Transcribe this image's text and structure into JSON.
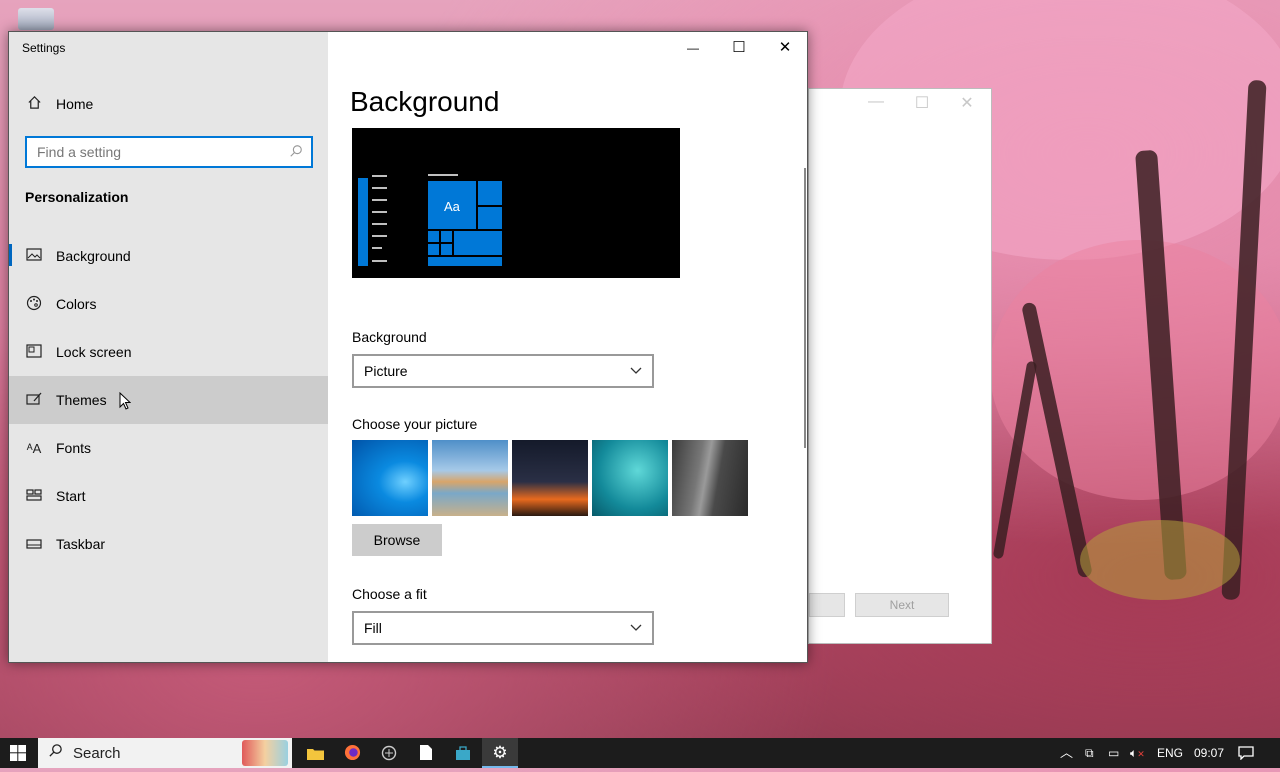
{
  "window": {
    "title": "Settings",
    "minimize": "—",
    "maximize": "☐",
    "close": "✕"
  },
  "sidebar": {
    "home_label": "Home",
    "search_placeholder": "Find a setting",
    "section_title": "Personalization",
    "items": [
      {
        "label": "Background",
        "icon": "picture-icon"
      },
      {
        "label": "Colors",
        "icon": "palette-icon"
      },
      {
        "label": "Lock screen",
        "icon": "lock-screen-icon"
      },
      {
        "label": "Themes",
        "icon": "themes-icon"
      },
      {
        "label": "Fonts",
        "icon": "fonts-icon"
      },
      {
        "label": "Start",
        "icon": "start-icon"
      },
      {
        "label": "Taskbar",
        "icon": "taskbar-icon"
      }
    ]
  },
  "main": {
    "title": "Background",
    "preview_tile_text": "Aa",
    "background_label": "Background",
    "background_value": "Picture",
    "choose_picture_label": "Choose your picture",
    "browse_label": "Browse",
    "fit_label": "Choose a fit",
    "fit_value": "Fill"
  },
  "bg_dialog": {
    "next_label": "Next"
  },
  "taskbar": {
    "search_text": "Search",
    "language": "ENG",
    "time": "09:07"
  },
  "colors": {
    "accent": "#0078d7",
    "sidebar": "#e6e6e6",
    "hover": "#cccccc"
  }
}
